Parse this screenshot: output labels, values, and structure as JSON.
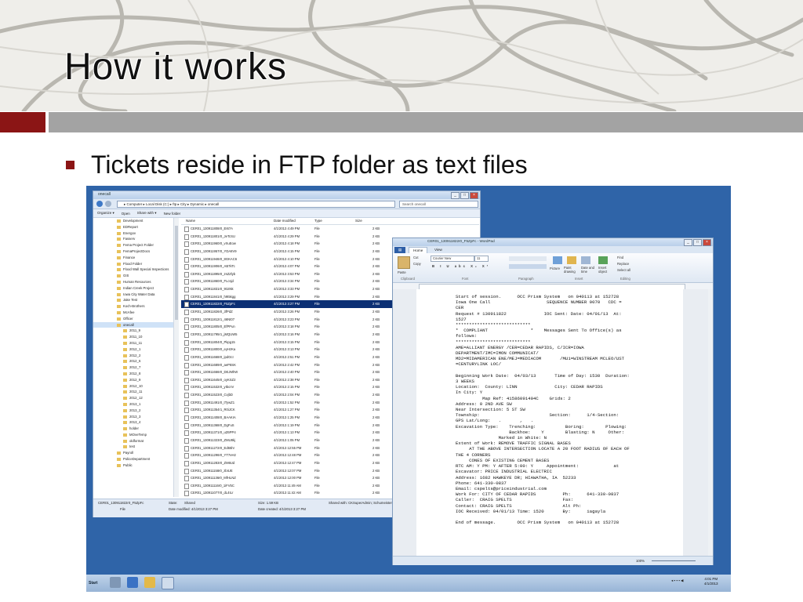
{
  "slide": {
    "title": "How it works",
    "bullet": "Tickets reside in FTP folder as text files"
  },
  "explorer": {
    "window_title": "onecall",
    "address": "▸ Computer ▸ Local Disk (C:) ▸ ftp ▸ City ▸ Dynamic ▸ onecall",
    "search_placeholder": "Search onecall",
    "toolbar": [
      "Organize ▾",
      "Open",
      "Share with ▾",
      "New folder"
    ],
    "nav_items": [
      {
        "label": "Development",
        "sub": false
      },
      {
        "label": "EDReport",
        "sub": false
      },
      {
        "label": "Energov",
        "sub": false
      },
      {
        "label": "Fasserv",
        "sub": false
      },
      {
        "label": "Fema Project Folder",
        "sub": false
      },
      {
        "label": "FemaProjectDocs",
        "sub": false
      },
      {
        "label": "Finance",
        "sub": false
      },
      {
        "label": "Flood Folder",
        "sub": false
      },
      {
        "label": "Flood Wall Special Inspections",
        "sub": false
      },
      {
        "label": "GIS",
        "sub": false
      },
      {
        "label": "Human Resources",
        "sub": false
      },
      {
        "label": "Indian Creek Project",
        "sub": false
      },
      {
        "label": "Iowa City Water Data",
        "sub": false
      },
      {
        "label": "Jake Test",
        "sub": false
      },
      {
        "label": "Koch-Brothers",
        "sub": false
      },
      {
        "label": "McAfee",
        "sub": false
      },
      {
        "label": "Officer",
        "sub": false
      },
      {
        "label": "onecall",
        "sub": false,
        "selected": true
      },
      {
        "label": "2011_9",
        "sub": true
      },
      {
        "label": "2011_10",
        "sub": true
      },
      {
        "label": "2011_11",
        "sub": true
      },
      {
        "label": "2012_1",
        "sub": true
      },
      {
        "label": "2012_2",
        "sub": true
      },
      {
        "label": "2012_6",
        "sub": true
      },
      {
        "label": "2012_7",
        "sub": true
      },
      {
        "label": "2012_8",
        "sub": true
      },
      {
        "label": "2012_9",
        "sub": true
      },
      {
        "label": "2012_10",
        "sub": true
      },
      {
        "label": "2012_11",
        "sub": true
      },
      {
        "label": "2012_12",
        "sub": true
      },
      {
        "label": "2013_1",
        "sub": true
      },
      {
        "label": "2013_2",
        "sub": true
      },
      {
        "label": "2013_3",
        "sub": true
      },
      {
        "label": "2013_4",
        "sub": true
      },
      {
        "label": "holder",
        "sub": true
      },
      {
        "label": "MOveTemp",
        "sub": true
      },
      {
        "label": "oldformat",
        "sub": true
      },
      {
        "label": "test",
        "sub": true
      },
      {
        "label": "Payroll",
        "sub": false
      },
      {
        "label": "PoliceDepartment",
        "sub": false
      },
      {
        "label": "Public",
        "sub": false
      }
    ],
    "columns": [
      "Name",
      "Date modified",
      "Type",
      "Size"
    ],
    "files": [
      {
        "name": "CER01_130911808r0_EI67A",
        "date": "4/1/2013 4:49 PM",
        "type": "File",
        "size": "2 KB"
      },
      {
        "name": "CER01_130911801r0_JeTcSU",
        "date": "4/1/2013 4:29 PM",
        "type": "File",
        "size": "2 KB"
      },
      {
        "name": "CER01_130911960r0_vXuEow",
        "date": "4/1/2013 4:18 PM",
        "type": "File",
        "size": "2 KB"
      },
      {
        "name": "CER01_130911957r0_YDA8V9",
        "date": "4/1/2013 4:15 PM",
        "type": "File",
        "size": "2 KB"
      },
      {
        "name": "CER01_130911946r0_8GKAC6",
        "date": "4/1/2013 4:10 PM",
        "type": "File",
        "size": "2 KB"
      },
      {
        "name": "CER01_130911906r0_AB7kTc",
        "date": "4/1/2013 4:07 PM",
        "type": "File",
        "size": "2 KB"
      },
      {
        "name": "CER01_130911895r0_zsZZlyb",
        "date": "4/1/2013 3:53 PM",
        "type": "File",
        "size": "2 KB"
      },
      {
        "name": "CER01_130911860r0_FLcsjd",
        "date": "4/1/2013 3:34 PM",
        "type": "File",
        "size": "2 KB"
      },
      {
        "name": "CER01_130911831r0_9t1tNk",
        "date": "4/1/2013 3:33 PM",
        "type": "File",
        "size": "2 KB"
      },
      {
        "name": "CER01_130911841r0_h9t5kgg",
        "date": "4/1/2013 3:29 PM",
        "type": "File",
        "size": "2 KB"
      },
      {
        "name": "CER01_130911822r0_F5ZpFc",
        "date": "4/1/2013 3:27 PM",
        "type": "File",
        "size": "2 KB",
        "selected": true
      },
      {
        "name": "CER01_130911826r0_3fPdZ",
        "date": "4/1/2013 3:26 PM",
        "type": "File",
        "size": "2 KB"
      },
      {
        "name": "CER01_130911812r1_46Nt07",
        "date": "4/1/2013 3:23 PM",
        "type": "File",
        "size": "2 KB"
      },
      {
        "name": "CER01_130911805r0_EfPPun",
        "date": "4/1/2013 3:18 PM",
        "type": "File",
        "size": "2 KB"
      },
      {
        "name": "CER01_130911795r1_jMQUW5",
        "date": "4/1/2013 3:16 PM",
        "type": "File",
        "size": "2 KB"
      },
      {
        "name": "CER01_130911804r0_Pkpg15",
        "date": "4/1/2013 3:15 PM",
        "type": "File",
        "size": "2 KB"
      },
      {
        "name": "CER01_130911800r0_eyHzKa",
        "date": "4/1/2013 3:13 PM",
        "type": "File",
        "size": "2 KB"
      },
      {
        "name": "CER01_130911668r0_ipdOcI",
        "date": "4/1/2013 2:51 PM",
        "type": "File",
        "size": "2 KB"
      },
      {
        "name": "CER01_130911689r0_aeP8SK",
        "date": "4/1/2013 2:42 PM",
        "type": "File",
        "size": "2 KB"
      },
      {
        "name": "CER01_130911666r0_DEJMhW",
        "date": "4/1/2013 2:40 PM",
        "type": "File",
        "size": "2 KB"
      },
      {
        "name": "CER01_130911645r0_oyKSZ2",
        "date": "4/1/2013 2:38 PM",
        "type": "File",
        "size": "2 KB"
      },
      {
        "name": "CER01_130911532r0_yIbcnV",
        "date": "4/1/2013 2:15 PM",
        "type": "File",
        "size": "2 KB"
      },
      {
        "name": "CER01_130911523r0_CvjbD",
        "date": "4/1/2013 2:04 PM",
        "type": "File",
        "size": "2 KB"
      },
      {
        "name": "CER01_130911491r0_tTywZ1",
        "date": "4/1/2013 1:52 PM",
        "type": "File",
        "size": "2 KB"
      },
      {
        "name": "CER01_130911354r1_R0iJCK",
        "date": "4/1/2013 1:27 PM",
        "type": "File",
        "size": "2 KB"
      },
      {
        "name": "CER01_130911408r0_BAAKIA",
        "date": "4/1/2013 1:25 PM",
        "type": "File",
        "size": "2 KB"
      },
      {
        "name": "CER01_130911368r0_DgFuS",
        "date": "4/1/2013 1:19 PM",
        "type": "File",
        "size": "2 KB"
      },
      {
        "name": "CER01_130911371r0_uZ6PP4",
        "date": "4/1/2013 1:13 PM",
        "type": "File",
        "size": "2 KB"
      },
      {
        "name": "CER01_130911323r0_ZMU8kj",
        "date": "4/1/2013 1:05 PM",
        "type": "File",
        "size": "2 KB"
      },
      {
        "name": "CER01_130911272r0_Ed65hr",
        "date": "4/1/2013 12:55 PM",
        "type": "File",
        "size": "2 KB"
      },
      {
        "name": "CER01_130911296r0_YT7eH2",
        "date": "4/1/2013 12:48 PM",
        "type": "File",
        "size": "2 KB"
      },
      {
        "name": "CER01_130911283r0_ZM6Ud",
        "date": "4/1/2013 12:47 PM",
        "type": "File",
        "size": "2 KB"
      },
      {
        "name": "CER01_130911158r0_zbIUE",
        "date": "4/1/2013 12:07 PM",
        "type": "File",
        "size": "2 KB"
      },
      {
        "name": "CER01_130911136r0_MfHLNZ",
        "date": "4/1/2013 12:00 PM",
        "type": "File",
        "size": "2 KB"
      },
      {
        "name": "CER01_130911116r0_1iFV5C",
        "date": "4/1/2013 11:49 AM",
        "type": "File",
        "size": "2 KB"
      },
      {
        "name": "CER01_130911077r0_dL4ILr",
        "date": "4/1/2013 11:42 AM",
        "type": "File",
        "size": "2 KB"
      }
    ],
    "details": {
      "name": "CER01_130911822r0_F5ZpFc",
      "type": "File",
      "state_label": "State:",
      "state": "Shared",
      "size": "Size: 1.59 KB",
      "modified": "Date modified: 4/1/2013 3:27 PM",
      "created": "Date created: 4/1/2013 3:27 PM",
      "shared_with": "Shared with: CKSuperAdmin; Schumeister; Jeco"
    }
  },
  "wordpad": {
    "window_title": "CER01_130911822r0_F5ZpFc - WordPad",
    "tabs": [
      "Home",
      "View"
    ],
    "font_name": "Courier New",
    "font_size": "11",
    "ribbon": {
      "paste": "Paste",
      "cut": "Cut",
      "copy": "Copy",
      "picture": "Picture",
      "paint_drawing": "Paint drawing",
      "date_time": "Date and time",
      "insert_object": "Insert object",
      "find": "Find",
      "replace": "Replace",
      "select_all": "Select all",
      "groups": [
        "Clipboard",
        "Font",
        "Paragraph",
        "Insert",
        "Editing"
      ]
    },
    "document": "Start of session.      OCC Prism System   on 040113 at 152728\nIowa One Call                     SEQUENCE NUMBER 0070   CDC =\nCER\nRequest # 130911822              IOC Sent: Date: 04/01/13  At:\n1527\n****************************\n*  COMPLIANT                *    Messages Sent To Office(s) as\nfollows:\n****************************\nAME=ALLIANT ENERGY /CER=CEDAR RAPIDS, C/ICR=IOWA\nDEPARTMENT/IMC=IMON COMMUNICAT/\nMD2=MIDAMERICAN ENE/MEJ=MEDIACOM       /MU1=WINSTREAM MCLEO/UST\n=CENTURYLINK LOC/\n\nBeginning Work Date:  04/03/13       Time of Day: 1530  Duration:\n3 WEEKS\nLocation:  County: LINN              City: CEDAR RAPIDS\nIn City: Y\n          Map Ref: 41586091404C    Grids: 2\nAddress: 0 2ND AVE SW\nNear Intersection: 5 ST SW\nTownship:                          Section:      1/4-Section:\nGPS Lat/Long:   .       ,   .\nExcavation Type:    Trenching:           Boring:        Plowing:\n                    Backhoe:    Y        Blasting: N     Other:\n                Marked in White: N\nExtent of Work: REMOVE TRAFFIC SIGNAL BASES\n     AT THE ABOVE INTERSECTION LOCATE A 20 FOOT RADIUS OF EACH OF\nTHE 4 CORNERS\n     CONES OF EXISTING CEMENT BASES\nRTC AM: Y PM: Y AFTER 5:00: Y     Appointment:             at\nExcavator: PRICE INDUSTRIAL ELECTRIC\nAddress: 1682 HAWKEYE DR; HIAWATHA, IA  52233\nPhone: 641-330-0837\nEmail: cspelts@priceindustrial.com\nWork For: CITY OF CEDAR RAPIDS          Ph:      641-330-0837\nCaller:  CRAIG SPELTS                   Fax:\nContact: CRAIG SPELTS                   Alt Ph:\nIOC Received: 04/01/13 Time: 1520       By:      iagayla\n\nEnd of message.        OCC Prism System   on 040113 at 152728",
    "zoom": "100%"
  },
  "taskbar": {
    "start": "Start",
    "time": "4:01 PM",
    "date": "4/1/2013"
  }
}
